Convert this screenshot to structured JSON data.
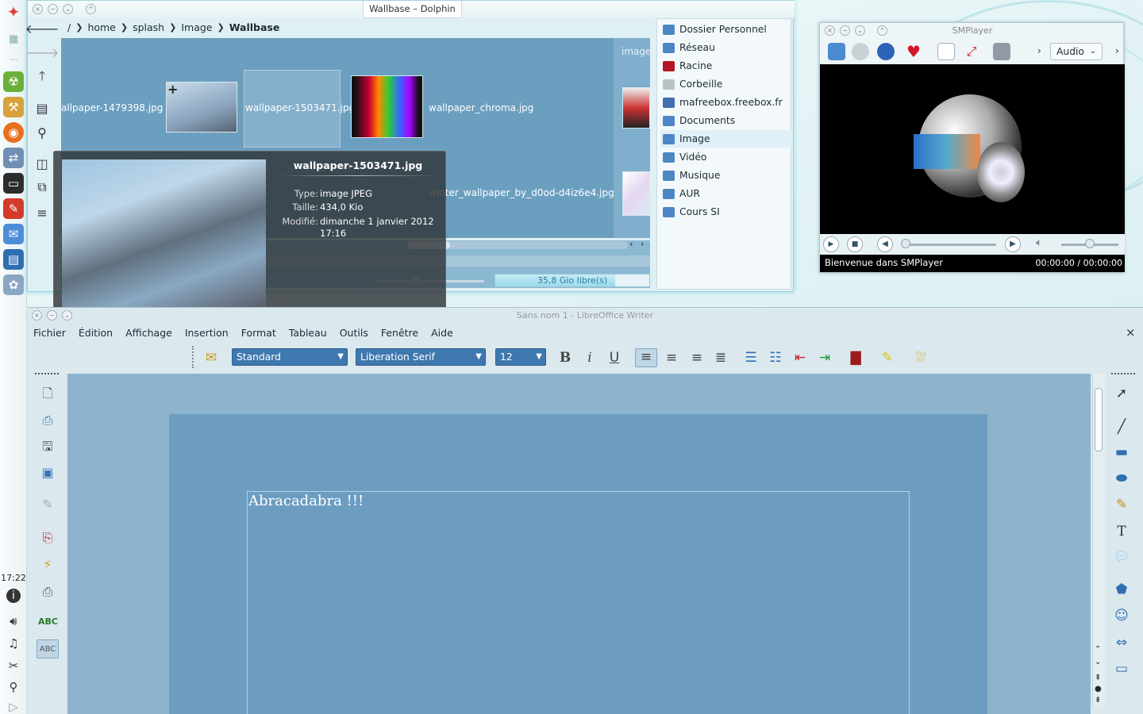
{
  "panel": {
    "clock": "17:22",
    "icons": [
      "launcher-icon",
      "view-icon",
      "apps-green-icon",
      "tools-icon",
      "firefox-icon",
      "network-icon",
      "terminal-icon",
      "acrobat-icon",
      "mail-icon",
      "office-icon",
      "paint-icon"
    ],
    "tray": [
      "info-icon",
      "volume-icon",
      "music-icon",
      "scissors-icon",
      "usb-icon",
      "expand-icon"
    ]
  },
  "dolphin": {
    "title": "Wallbase – Dolphin",
    "breadcrumbs": [
      "/",
      "home",
      "splash",
      "Image",
      "Wallbase"
    ],
    "column_label": "image",
    "files": [
      {
        "name": "allpaper-1479398.jpg"
      },
      {
        "name": "wallpaper-1503471.jpg"
      },
      {
        "name": "wallpaper_chroma.jpg"
      },
      {
        "name": "winter_wallpaper_by_d0od-d4iz6e4.jpg"
      }
    ],
    "free_space": "35,8 Gio libre(s)",
    "free_fraction": 0.78,
    "places": [
      {
        "label": "Dossier Personnel",
        "icon": "folder-home-icon",
        "color": "#4d86c5"
      },
      {
        "label": "Réseau",
        "icon": "network-folder-icon",
        "color": "#4d86c5"
      },
      {
        "label": "Racine",
        "icon": "root-folder-icon",
        "color": "#b01722"
      },
      {
        "label": "Corbeille",
        "icon": "trash-icon",
        "color": "#b9c2c6"
      },
      {
        "label": "mafreebox.freebox.fr",
        "icon": "network-share-icon",
        "color": "#3f6fb0"
      },
      {
        "label": "Documents",
        "icon": "folder-documents-icon",
        "color": "#4d86c5"
      },
      {
        "label": "Image",
        "icon": "folder-image-icon",
        "color": "#4d86c5"
      },
      {
        "label": "Vidéo",
        "icon": "folder-video-icon",
        "color": "#4d86c5"
      },
      {
        "label": "Musique",
        "icon": "folder-music-icon",
        "color": "#4d86c5"
      },
      {
        "label": "AUR",
        "icon": "folder-icon",
        "color": "#4d86c5"
      },
      {
        "label": "Cours SI",
        "icon": "folder-icon",
        "color": "#4d86c5"
      }
    ],
    "selected_place": "Image"
  },
  "tooltip": {
    "filename": "wallpaper-1503471.jpg",
    "type_label": "Type:",
    "type_value": "image JPEG",
    "size_label": "Taille:",
    "size_value": "434,0 Kio",
    "modified_label": "Modifié:",
    "modified_value": "dimanche 1 janvier 2012",
    "modified_time": "17:16"
  },
  "smplayer": {
    "title": "SMPlayer",
    "audio_label": "Audio",
    "status": "Bienvenue dans SMPlayer",
    "time": "00:00:00 / 00:00:00"
  },
  "writer": {
    "title": "Sans nom 1 - LibreOffice Writer",
    "menus": [
      "Fichier",
      "Édition",
      "Affichage",
      "Insertion",
      "Format",
      "Tableau",
      "Outils",
      "Fenêtre",
      "Aide"
    ],
    "style": "Standard",
    "font": "Liberation Serif",
    "size": "12",
    "document_text": "Abracadabra !!!"
  }
}
